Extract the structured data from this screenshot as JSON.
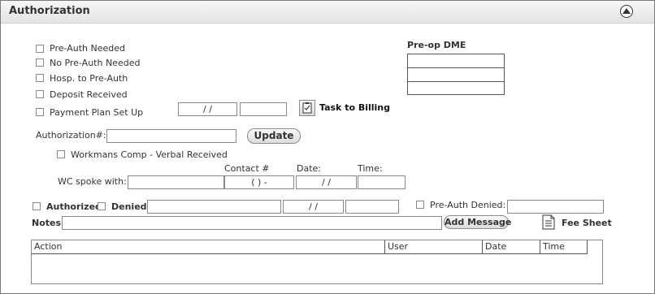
{
  "panel": {
    "title": "Authorization"
  },
  "checks": {
    "pre_auth_needed": "Pre-Auth Needed",
    "no_pre_auth_needed": "No Pre-Auth Needed",
    "hosp_to_pre_auth": "Hosp. to Pre-Auth",
    "deposit_received": "Deposit Received",
    "payment_plan": "Payment Plan Set Up"
  },
  "payment_plan": {
    "date_value": "/ /",
    "amount_value": ""
  },
  "task_to_billing": {
    "label": "Task to Billing",
    "icon": "clipboard-check-icon"
  },
  "pre_op_dme": {
    "title": "Pre-op DME",
    "rows": [
      "",
      "",
      ""
    ]
  },
  "authorization": {
    "label": "Authorization#:",
    "value": "",
    "update_label": "Update"
  },
  "workmans_comp": {
    "label": "Workmans Comp - Verbal Received"
  },
  "wc": {
    "label": "WC spoke with:",
    "contact_header": "Contact #",
    "date_header": "Date:",
    "time_header": "Time:",
    "name_value": "",
    "contact_value": "(   )    -",
    "date_value": "/ /",
    "time_value": ""
  },
  "status": {
    "authorized": "Authorized",
    "denied": "Denied",
    "field1_value": "",
    "date_value": "/ /",
    "field3_value": "",
    "pre_auth_denied": "Pre-Auth Denied:",
    "pre_auth_denied_value": ""
  },
  "notes": {
    "label": "Notes",
    "value": "",
    "add_message": "Add Message"
  },
  "fee_sheet": {
    "label": "Fee Sheet",
    "icon": "document-icon"
  },
  "message_grid": {
    "columns": [
      "Action",
      "User",
      "Date",
      "Time"
    ],
    "rows": []
  }
}
